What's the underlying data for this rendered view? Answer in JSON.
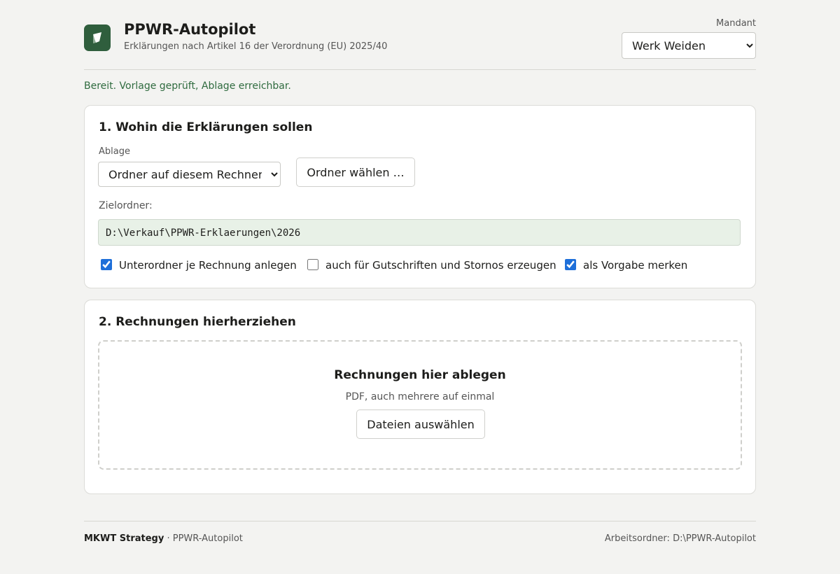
{
  "header": {
    "title": "PPWR-Autopilot",
    "subtitle": "Erklärungen nach Artikel 16 der Verordnung (EU) 2025/40",
    "logo_icon": "arrow-leaf-icon",
    "brand_color": "#2f5e3d",
    "mandant_label": "Mandant",
    "mandant_value": "Werk Weiden"
  },
  "status": {
    "text": "Bereit. Vorlage geprüft, Ablage erreichbar.",
    "color": "#2f6b3f"
  },
  "section1": {
    "title": "1. Wohin die Erklärungen sollen",
    "ablage_label": "Ablage",
    "ablage_value": "Ordner auf diesem Rechner",
    "choose_folder_label": "Ordner wählen …",
    "zielordner_label": "Zielordner:",
    "zielordner_value": "D:\\Verkauf\\PPWR-Erklaerungen\\2026",
    "checkboxes": [
      {
        "label": "Unterordner je Rechnung anlegen",
        "checked": true
      },
      {
        "label": "auch für Gutschriften und Stornos erzeugen",
        "checked": false
      },
      {
        "label": "als Vorgabe merken",
        "checked": true
      }
    ]
  },
  "section2": {
    "title": "2. Rechnungen hierherziehen",
    "drop_title": "Rechnungen hier ablegen",
    "drop_hint": "PDF, auch mehrere auf einmal",
    "choose_files_label": "Dateien auswählen"
  },
  "footer": {
    "brand": "MKWT Strategy",
    "separator_product": " · PPWR-Autopilot",
    "workdir": "Arbeitsordner: D:\\PPWR-Autopilot"
  }
}
